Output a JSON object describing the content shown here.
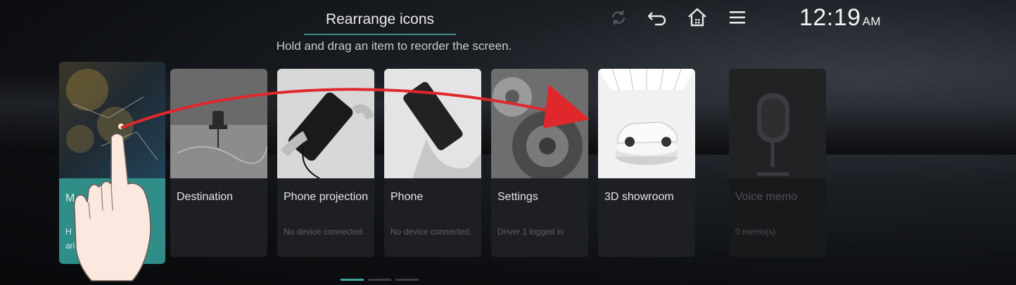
{
  "header": {
    "title": "Rearrange icons",
    "subtitle": "Hold and drag an item to reorder the screen."
  },
  "topbar": {
    "icons": [
      "refresh-icon",
      "back-icon",
      "home-icon",
      "menu-icon"
    ],
    "time": "12:19",
    "ampm": "AM"
  },
  "cards": [
    {
      "label": "M",
      "sub": "H",
      "sub2": "ari       ey"
    },
    {
      "label": "Destination",
      "sub": ""
    },
    {
      "label": "Phone projection",
      "sub": "No device connected."
    },
    {
      "label": "Phone",
      "sub": "No device connected."
    },
    {
      "label": "Settings",
      "sub": "Driver 1 logged in"
    },
    {
      "label": "3D showroom",
      "sub": ""
    },
    {
      "label": "Voice memo",
      "sub": "0 memo(s)"
    }
  ],
  "pagination": {
    "pages": 3,
    "active": 1
  },
  "colors": {
    "accent": "#3fa59d",
    "drag_arrow": "#e0282c",
    "card_bg": "#1d1f22",
    "selected_card": "#2f8f88"
  }
}
